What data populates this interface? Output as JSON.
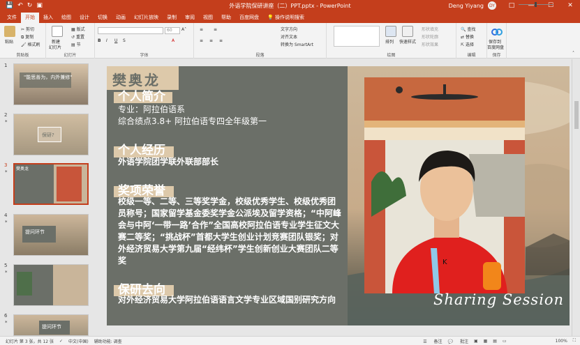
{
  "window": {
    "title": "外语学院保研讲座（二）PPT.pptx - PowerPoint",
    "user": "Deng Yiyang",
    "avatar": "DY"
  },
  "qat": [
    "save-icon",
    "undo-icon",
    "redo-icon",
    "start-from-beginning-icon"
  ],
  "tabs": [
    "文件",
    "开始",
    "插入",
    "绘图",
    "设计",
    "切换",
    "动画",
    "幻灯片放映",
    "录制",
    "审阅",
    "视图",
    "帮助",
    "百度网盘"
  ],
  "active_tab": "开始",
  "tell_me": "操作说明搜索",
  "ribbon": {
    "clipboard": {
      "paste": "粘贴",
      "cut": "剪切",
      "copy": "复制",
      "format_painter": "格式刷",
      "label": "剪贴板"
    },
    "slides": {
      "new_slide": "新建",
      "new_slide2": "幻灯片",
      "layout": "版式",
      "reset": "重置",
      "section": "节",
      "label": "幻灯片"
    },
    "font": {
      "size": "60",
      "bold": "B",
      "italic": "I",
      "underline": "U",
      "strike": "S",
      "label": "字体"
    },
    "paragraph": {
      "text_direction": "文字方向",
      "align_text": "对齐文本",
      "smartart": "转换为 SmartArt",
      "label": "段落"
    },
    "drawing": {
      "arrange": "排列",
      "quick_styles": "快速样式",
      "fill": "形状填充",
      "outline": "形状轮廓",
      "effects": "形状效果",
      "label": "绘图"
    },
    "editing": {
      "find": "查找",
      "replace": "替换",
      "select": "选择",
      "label": "编辑"
    },
    "save": {
      "save_to_baidu": "保存到",
      "baidu_disk": "百度网盘",
      "label": "保存"
    }
  },
  "thumbnails": [
    {
      "num": "1",
      "title": "\"能思善为，内外兼修\""
    },
    {
      "num": "2",
      "title": "保研?"
    },
    {
      "num": "3",
      "title": "樊奥龙"
    },
    {
      "num": "4",
      "title": "提问环节"
    },
    {
      "num": "5",
      "title": ""
    },
    {
      "num": "6",
      "title": "提问环节"
    }
  ],
  "slide": {
    "name": "樊奥龙",
    "section1_title": "个人简介",
    "section1_line1": "专业：阿拉伯语系",
    "section1_line2": "综合绩点3.8+ 阿拉伯语专四全年级第一",
    "section2_title": "个人经历",
    "section2_line1": "外语学院团学联外联部部长",
    "section3_title": "奖项荣誉",
    "section3_body": "校级一等、二等、三等奖学金，校级优秀学生、校级优秀团员称号；国家留学基金委奖学金公派埃及留学资格；“中阿峰会与中阿‘一带一路’合作”全国高校阿拉伯语专业学生征文大赛二等奖；“挑战杯”首都大学生创业计划竞赛团队银奖；对外经济贸易大学第九届“经纬杯”学生创新创业大赛团队二等奖",
    "section4_title": "保研去向",
    "section4_body": "对外经济贸易大学阿拉伯语语言文学专业区域国别研究方向",
    "sharing": "Sharing Session"
  },
  "status": {
    "slide_info": "幻灯片 第 3 张，共 12 张",
    "language": "中文(中国)",
    "accessibility": "辅助功能: 调查",
    "notes": "备注",
    "comments": "批注",
    "zoom": "100%"
  }
}
